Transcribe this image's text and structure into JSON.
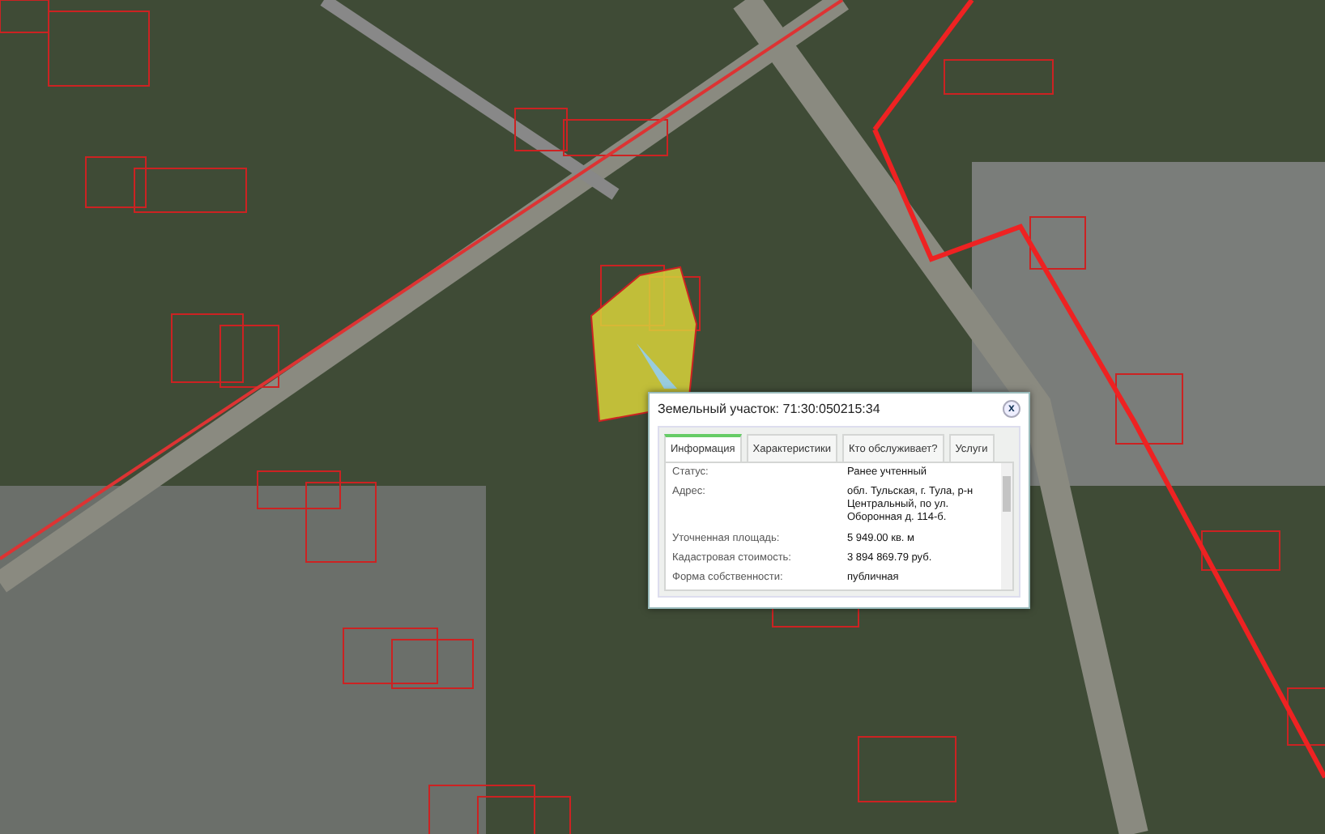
{
  "popup": {
    "title": "Земельный участок: 71:30:050215:34",
    "close": "x",
    "tabs": [
      {
        "label": "Информация",
        "selected": true
      },
      {
        "label": "Характеристики",
        "selected": false
      },
      {
        "label": "Кто обслуживает?",
        "selected": false
      },
      {
        "label": "Услуги",
        "selected": false
      }
    ],
    "fields": [
      {
        "label": "Статус:",
        "value": "Ранее учтенный"
      },
      {
        "label": "Адрес:",
        "value": "обл. Тульская, г. Тула, р-н Центральный, по ул. Оборонная д. 114-б."
      },
      {
        "label": "Уточненная площадь:",
        "value": "5 949.00 кв. м"
      },
      {
        "label": "Кадастровая стоимость:",
        "value": "3 894 869.79 руб."
      },
      {
        "label": "Форма собственности:",
        "value": "публичная"
      }
    ]
  }
}
